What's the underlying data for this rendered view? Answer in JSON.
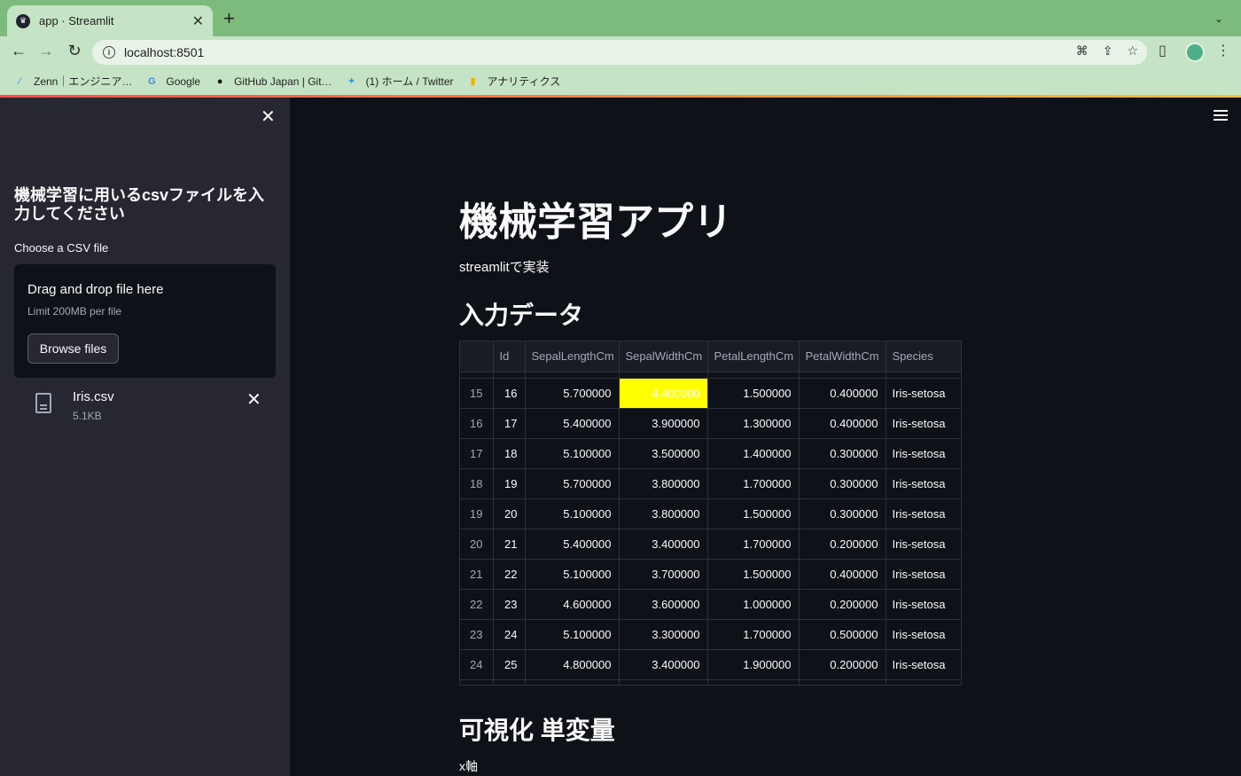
{
  "browser": {
    "tab_title": "app · Streamlit",
    "new_tab": "+",
    "url": "localhost:8501",
    "bookmarks": [
      {
        "icon": "zenn-icon",
        "label": "Zenn｜エンジニア…"
      },
      {
        "icon": "google-icon",
        "label": "Google"
      },
      {
        "icon": "github-icon",
        "label": "GitHub Japan | Git…"
      },
      {
        "icon": "twitter-icon",
        "label": "(1) ホーム / Twitter"
      },
      {
        "icon": "analytics-icon",
        "label": "アナリティクス"
      }
    ]
  },
  "sidebar": {
    "header": "機械学習に用いるcsvファイルを入力してください",
    "uploader_label": "Choose a CSV file",
    "drop_title": "Drag and drop file here",
    "drop_limit": "Limit 200MB per file",
    "browse_label": "Browse files",
    "file": {
      "name": "Iris.csv",
      "size": "5.1KB"
    }
  },
  "main": {
    "title": "機械学習アプリ",
    "subtitle": "streamlitで実装",
    "section_data": "入力データ",
    "section_viz": "可視化 単変量",
    "x_axis_label": "x軸",
    "table": {
      "columns": [
        "",
        "Id",
        "SepalLengthCm",
        "SepalWidthCm",
        "PetalLengthCm",
        "PetalWidthCm",
        "Species"
      ],
      "rows": [
        [
          "15",
          "16",
          "5.700000",
          "4.400000",
          "1.500000",
          "0.400000",
          "Iris-setosa"
        ],
        [
          "16",
          "17",
          "5.400000",
          "3.900000",
          "1.300000",
          "0.400000",
          "Iris-setosa"
        ],
        [
          "17",
          "18",
          "5.100000",
          "3.500000",
          "1.400000",
          "0.300000",
          "Iris-setosa"
        ],
        [
          "18",
          "19",
          "5.700000",
          "3.800000",
          "1.700000",
          "0.300000",
          "Iris-setosa"
        ],
        [
          "19",
          "20",
          "5.100000",
          "3.800000",
          "1.500000",
          "0.300000",
          "Iris-setosa"
        ],
        [
          "20",
          "21",
          "5.400000",
          "3.400000",
          "1.700000",
          "0.200000",
          "Iris-setosa"
        ],
        [
          "21",
          "22",
          "5.100000",
          "3.700000",
          "1.500000",
          "0.400000",
          "Iris-setosa"
        ],
        [
          "22",
          "23",
          "4.600000",
          "3.600000",
          "1.000000",
          "0.200000",
          "Iris-setosa"
        ],
        [
          "23",
          "24",
          "5.100000",
          "3.300000",
          "1.700000",
          "0.500000",
          "Iris-setosa"
        ],
        [
          "24",
          "25",
          "4.800000",
          "3.400000",
          "1.900000",
          "0.200000",
          "Iris-setosa"
        ]
      ],
      "highlight_color": "#ffff00"
    }
  },
  "colors": {
    "app_bg": "#0e1117",
    "sidebar_bg": "#262730",
    "browser_frame": "#7dbb7d"
  }
}
